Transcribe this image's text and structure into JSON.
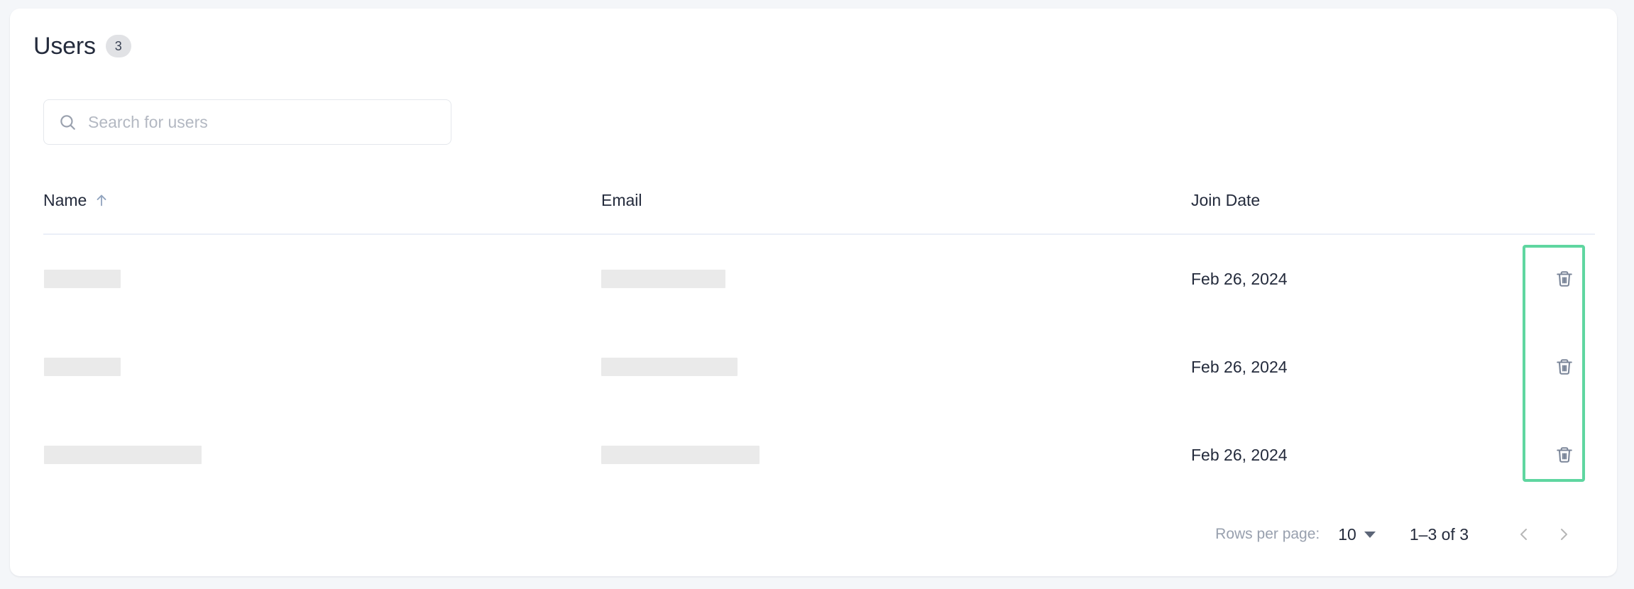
{
  "header": {
    "title": "Users",
    "count_badge": "3"
  },
  "search": {
    "placeholder": "Search for users",
    "value": "",
    "icon": "search-icon"
  },
  "table": {
    "columns": [
      {
        "key": "name",
        "label": "Name",
        "sorted": true,
        "sort_dir": "asc",
        "sort_icon": "arrow-up-icon"
      },
      {
        "key": "email",
        "label": "Email",
        "sorted": false
      },
      {
        "key": "date",
        "label": "Join Date",
        "sorted": false
      }
    ],
    "rows": [
      {
        "name_redacted": true,
        "name_width": 108,
        "email_redacted": true,
        "email_width": 175,
        "join_date": "Feb 26, 2024",
        "delete_icon": "trash-icon"
      },
      {
        "name_redacted": true,
        "name_width": 108,
        "email_redacted": true,
        "email_width": 192,
        "join_date": "Feb 26, 2024",
        "delete_icon": "trash-icon"
      },
      {
        "name_redacted": true,
        "name_width": 222,
        "email_redacted": true,
        "email_width": 223,
        "join_date": "Feb 26, 2024",
        "delete_icon": "trash-icon"
      }
    ]
  },
  "pagination": {
    "rows_per_page_label": "Rows per page:",
    "rows_per_page_value": "10",
    "rows_per_page_options": [
      "10"
    ],
    "range_label": "1–3 of 3",
    "prev_icon": "chevron-left-icon",
    "next_icon": "chevron-right-icon"
  },
  "annotation": {
    "highlight_color": "#5fd6a0",
    "target": "delete-column"
  },
  "colors": {
    "page_background": "#f4f6f9",
    "card_background": "#ffffff",
    "text_primary": "#242b3c",
    "text_muted": "#98a0ae",
    "divider": "#ebeff7",
    "redaction": "#eaeaea",
    "badge_background": "#e1e2e5",
    "icon_slate": "#7b8699",
    "sort_arrow": "#93a5bf",
    "highlight_green": "#5fd6a0"
  }
}
